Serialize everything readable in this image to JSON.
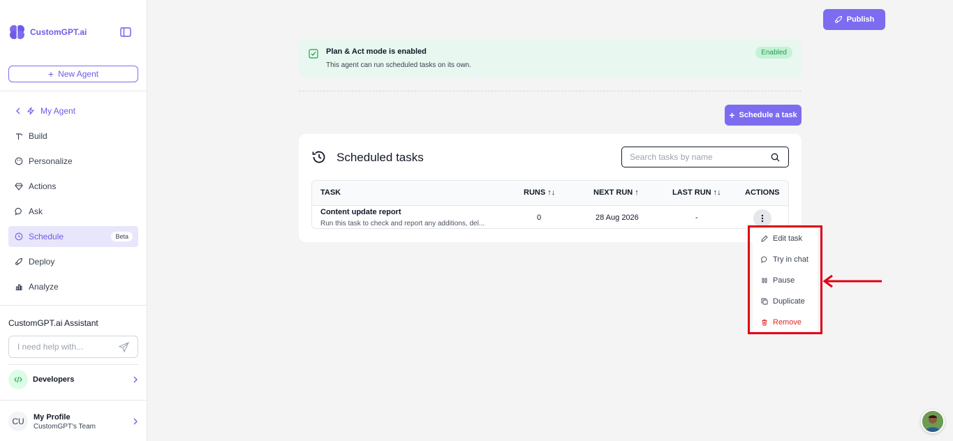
{
  "sidebar": {
    "brand": "CustomGPT.ai",
    "new_agent_label": "New Agent",
    "back_label": "My Agent",
    "items": [
      {
        "label": "Build",
        "icon": "hammer-icon"
      },
      {
        "label": "Personalize",
        "icon": "palette-icon"
      },
      {
        "label": "Actions",
        "icon": "gem-icon"
      },
      {
        "label": "Ask",
        "icon": "chat-bubble-icon"
      },
      {
        "label": "Schedule",
        "icon": "clock-icon",
        "badge": "Beta",
        "active": true
      },
      {
        "label": "Deploy",
        "icon": "rocket-icon"
      },
      {
        "label": "Analyze",
        "icon": "bar-chart-icon"
      }
    ],
    "assistant_title": "CustomGPT.ai Assistant",
    "assistant_placeholder": "I need help with...",
    "developers_label": "Developers",
    "profile": {
      "initials": "CU",
      "name": "My Profile",
      "team": "CustomGPT's Team"
    }
  },
  "header": {
    "publish_label": "Publish"
  },
  "banner": {
    "title": "Plan & Act mode is enabled",
    "description": "This agent can run scheduled tasks on its own.",
    "badge": "Enabled"
  },
  "schedule_button_label": "Schedule a task",
  "card": {
    "title": "Scheduled tasks",
    "search_placeholder": "Search tasks by name",
    "columns": {
      "task": "TASK",
      "runs": "RUNS ↑↓",
      "next_run": "NEXT RUN ↑",
      "last_run": "LAST RUN ↑↓",
      "actions": "ACTIONS"
    },
    "rows": [
      {
        "name": "Content update report",
        "description": "Run this task to check and report any additions, del...",
        "runs": "0",
        "next_run": "28 Aug 2026",
        "last_run": "-"
      }
    ]
  },
  "menu": {
    "items": [
      {
        "label": "Edit task",
        "icon": "pencil-icon"
      },
      {
        "label": "Try in chat",
        "icon": "chat-icon"
      },
      {
        "label": "Pause",
        "icon": "pause-icon"
      },
      {
        "label": "Duplicate",
        "icon": "copy-icon"
      },
      {
        "label": "Remove",
        "icon": "trash-icon",
        "danger": true
      }
    ]
  },
  "colors": {
    "accent": "#7c6cf0",
    "success": "#16a34a",
    "danger": "#dc2626",
    "annotation": "#e00012"
  }
}
